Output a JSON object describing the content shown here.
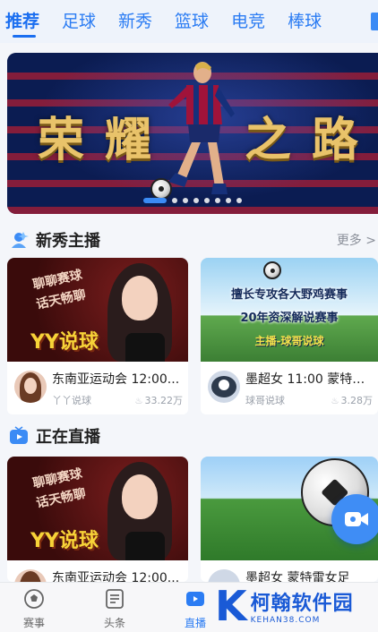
{
  "tabs": [
    "推荐",
    "足球",
    "新秀",
    "篮球",
    "电竞",
    "棒球"
  ],
  "banner": {
    "title_chars": [
      "荣",
      "耀",
      "之",
      "路"
    ],
    "slide_count": 8,
    "active_slide": 1
  },
  "section_new": {
    "title": "新秀主播",
    "more": "更多 >"
  },
  "section_live": {
    "title": "正在直播"
  },
  "cards_new": [
    {
      "thumb_lines": [
        "聊聊赛球",
        "话天畅聊"
      ],
      "thumb_brand": "YY说球",
      "title": "东南亚运动会 12:00...",
      "author": "丫丫说球",
      "views": "33.22万"
    },
    {
      "thumb_lines": [
        "擅长专攻各大野鸡赛事",
        "20年资深解说赛事",
        "主播-球哥说球"
      ],
      "title": "墨超女 11:00 蒙特雷...",
      "author": "球哥说球",
      "views": "3.28万"
    }
  ],
  "cards_live": [
    {
      "thumb_lines": [
        "聊聊赛球",
        "话天畅聊"
      ],
      "thumb_brand": "YY说球",
      "title": "东南亚运动会 12:00..."
    },
    {
      "title": "墨超女  蒙特雷女足"
    }
  ],
  "bottom_nav": [
    {
      "label": "赛事",
      "icon": "football-icon"
    },
    {
      "label": "头条",
      "icon": "news-icon"
    },
    {
      "label": "直播",
      "icon": "live-icon"
    }
  ],
  "watermark": {
    "letter": "K",
    "name": "柯翰软件园",
    "url": "KEHAN38.COM"
  },
  "colors": {
    "accent": "#2b7cf3",
    "gold": "#e9c36a"
  }
}
